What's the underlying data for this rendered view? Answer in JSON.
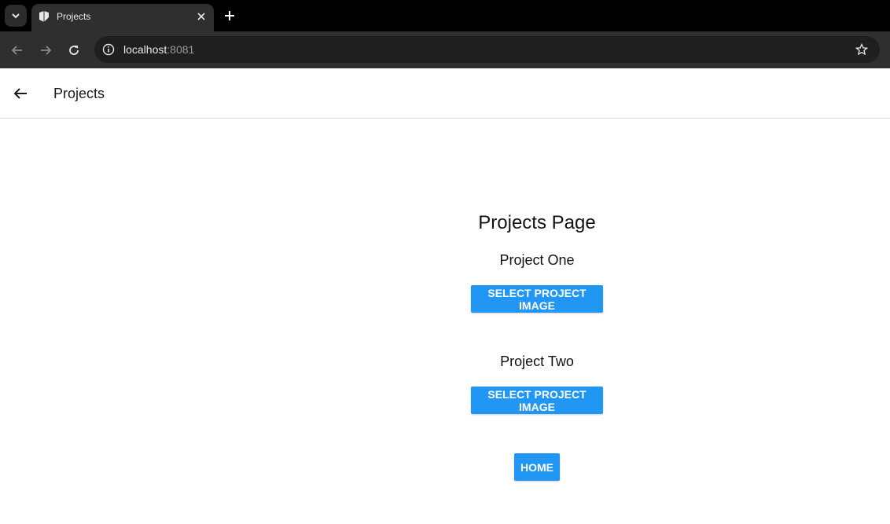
{
  "browser": {
    "tab_title": "Projects",
    "url_host": "localhost",
    "url_port": ":8081"
  },
  "app_header": {
    "title": "Projects"
  },
  "main": {
    "page_title": "Projects Page",
    "projects": [
      {
        "name": "Project One",
        "button_label": "SELECT PROJECT IMAGE"
      },
      {
        "name": "Project Two",
        "button_label": "SELECT PROJECT IMAGE"
      }
    ],
    "home_label": "HOME"
  },
  "colors": {
    "accent": "#2196f3",
    "chrome_dark": "#2f2f2f"
  }
}
